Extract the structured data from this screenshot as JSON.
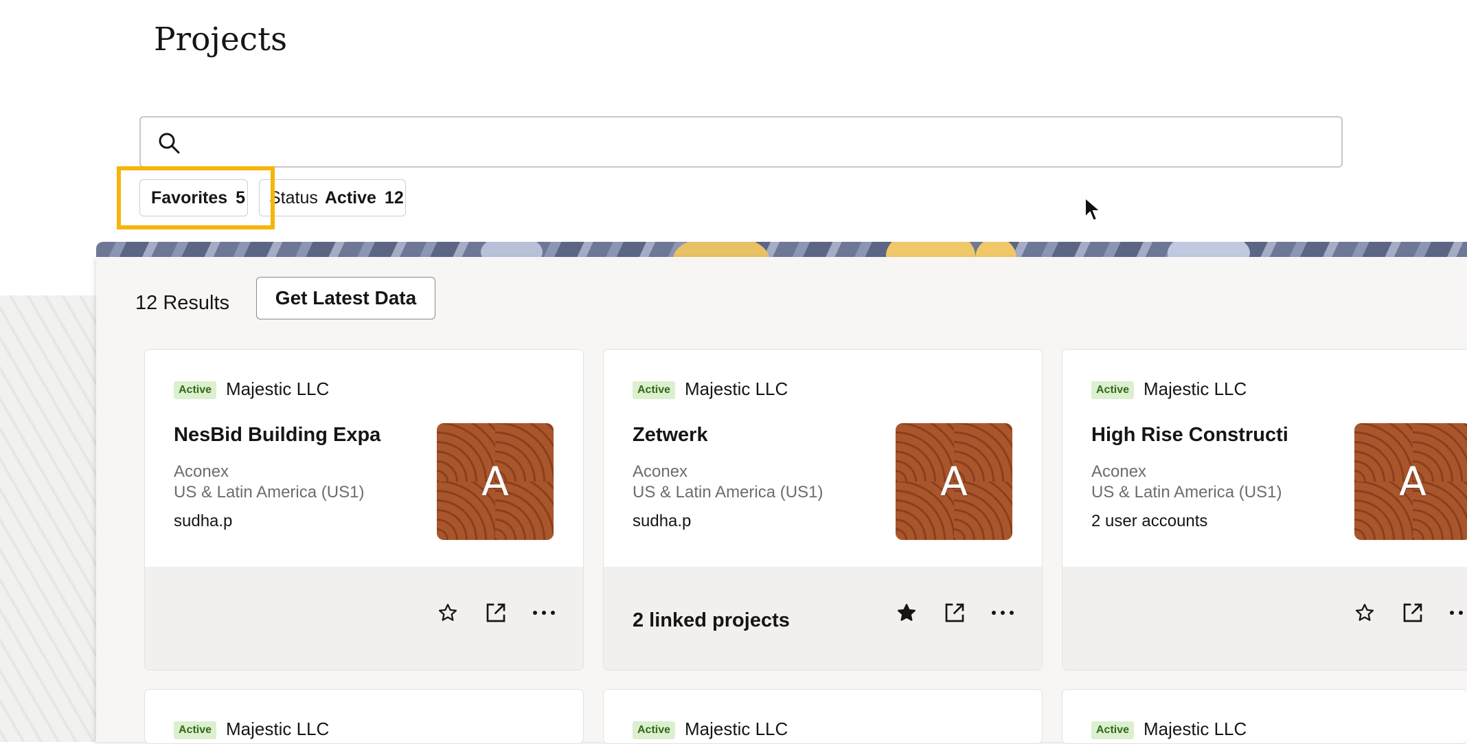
{
  "page": {
    "title": "Projects"
  },
  "search": {
    "placeholder": "",
    "value": ""
  },
  "filters": [
    {
      "label": "Favorites",
      "count": "5"
    },
    {
      "label": "Status",
      "value": "Active",
      "count": "12"
    }
  ],
  "results": {
    "count_label": "12 Results",
    "get_latest_label": "Get Latest Data"
  },
  "cards": [
    {
      "status": "Active",
      "org": "Majestic LLC",
      "name": "NesBid Building Expa",
      "service": "Aconex",
      "region": "US & Latin America (US1)",
      "owner": "sudha.p",
      "thumb_letter": "A",
      "linked": "",
      "favorite": false
    },
    {
      "status": "Active",
      "org": "Majestic LLC",
      "name": "Zetwerk",
      "service": "Aconex",
      "region": "US & Latin America (US1)",
      "owner": "sudha.p",
      "thumb_letter": "A",
      "linked": "2 linked projects",
      "favorite": true
    },
    {
      "status": "Active",
      "org": "Majestic LLC",
      "name": "High Rise Constructi",
      "service": "Aconex",
      "region": "US & Latin America (US1)",
      "owner": "2 user accounts",
      "thumb_letter": "A",
      "linked": "",
      "favorite": false
    },
    {
      "status": "Active",
      "org": "Majestic LLC"
    },
    {
      "status": "Active",
      "org": "Majestic LLC"
    },
    {
      "status": "Active",
      "org": "Majestic LLC"
    }
  ],
  "colors": {
    "highlight": "#f5b50b",
    "badge_bg": "#dcefcf",
    "badge_text": "#2f6b16",
    "thumb": "#9a4a25"
  },
  "icons": {
    "search": "search-icon",
    "star": "star-icon",
    "open": "open-external-icon",
    "more": "more-icon"
  }
}
